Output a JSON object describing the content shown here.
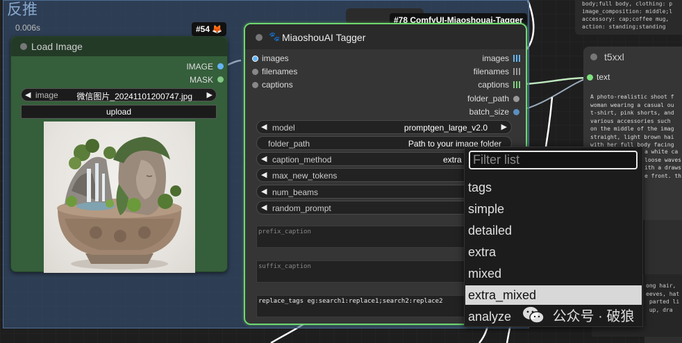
{
  "group": {
    "title": "反推"
  },
  "load_image": {
    "timing": "0.006s",
    "badge": "#54 🦊",
    "title": "Load Image",
    "outputs": [
      "IMAGE",
      "MASK"
    ],
    "image_widget": {
      "name": "image",
      "value": "微信图片_20241101200747.jpg"
    },
    "upload_label": "upload"
  },
  "tagger": {
    "badge": "#78 ComfyUI-Miaoshouai-Tagger",
    "title": "MiaoshouAI Tagger",
    "inputs": [
      "images",
      "filenames",
      "captions"
    ],
    "outputs": [
      "images",
      "filenames",
      "captions",
      "folder_path",
      "batch_size"
    ],
    "widgets": {
      "model": {
        "name": "model",
        "value": "promptgen_large_v2.0"
      },
      "folder_path": {
        "name": "folder_path",
        "value": "Path to your image folder"
      },
      "caption_method": {
        "name": "caption_method",
        "value": "extra"
      },
      "max_new_tokens": {
        "name": "max_new_tokens"
      },
      "num_beams": {
        "name": "num_beams"
      },
      "random_prompt": {
        "name": "random_prompt"
      }
    },
    "prefix_caption": "prefix_caption",
    "suffix_caption": "suffix_caption",
    "replace_tags": "replace_tags eg:search1:replace1;search2:replace2"
  },
  "t5xxl": {
    "title": "t5xxl",
    "input": "text",
    "text": "A photo-realistic shoot f\nwoman wearing a casual ou\nt-shirt, pink shorts, and\nvarious accessories such \non the middle of the imag\nstraight, light brown hai\nwith her full body facing",
    "text_partial": "a white ca\nloose waves \nith a drawst\ne front. th"
  },
  "top_text": "body;full body, clothing: p\nimage_composition: middle;l\naccessory: cap;coffee mug,\naction: standing;standing",
  "bottom_right_text": "ong hair,\neeves, hat\n parted li\n up, dra",
  "menu": {
    "filter_placeholder": "Filter list",
    "items": [
      "tags",
      "simple",
      "detailed",
      "extra",
      "mixed",
      "extra_mixed",
      "analyze"
    ],
    "selected": "extra_mixed"
  },
  "watermark": "公众号 · 破狼",
  "colors": {
    "group_bg": "#3a5880",
    "load_node_bg": "#355e3b",
    "tagger_border": "#6fd86f",
    "image_slot": "#64b5f6",
    "mask_slot": "#81c784",
    "menu_selected": "#d8d8d8"
  }
}
